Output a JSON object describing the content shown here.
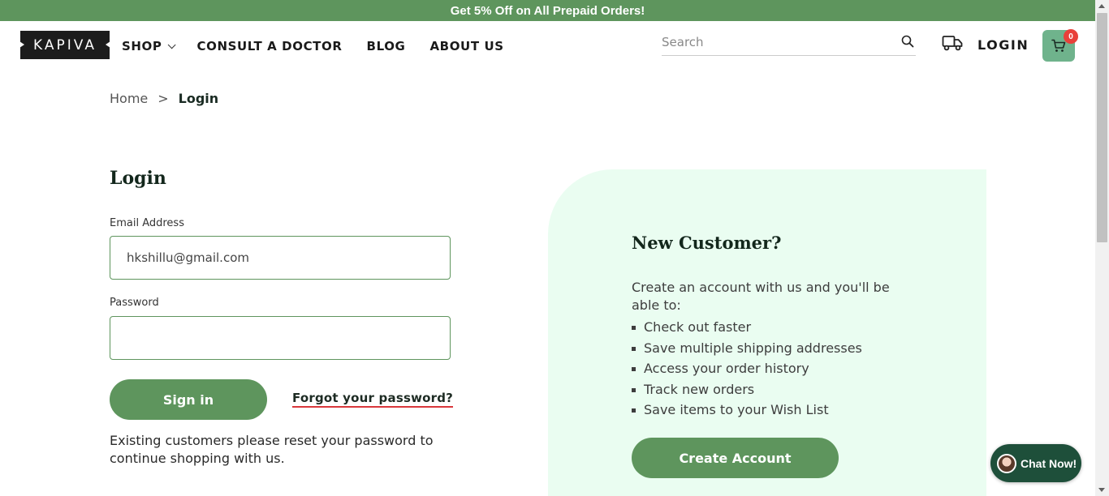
{
  "promo": {
    "text": "Get 5% Off on All Prepaid Orders!"
  },
  "header": {
    "logo_text": "KAPIVA",
    "nav": [
      {
        "label": "SHOP",
        "has_dropdown": true
      },
      {
        "label": "CONSULT A DOCTOR"
      },
      {
        "label": "BLOG"
      },
      {
        "label": "ABOUT US"
      }
    ],
    "search_placeholder": "Search",
    "login_label": "LOGIN",
    "cart_count": "0"
  },
  "breadcrumb": {
    "home": "Home",
    "separator": ">",
    "current": "Login"
  },
  "login_form": {
    "title": "Login",
    "email_label": "Email Address",
    "email_value": "hkshillu@gmail.com",
    "password_label": "Password",
    "password_value": "",
    "signin_label": "Sign in",
    "forgot_label": "Forgot your password?",
    "help_text": "Existing customers please reset your password to continue shopping with us."
  },
  "new_customer": {
    "title": "New Customer?",
    "intro": "Create an account with us and you'll be able to:",
    "benefits": [
      "Check out faster",
      "Save multiple shipping addresses",
      "Access your order history",
      "Track new orders",
      "Save items to your Wish List"
    ],
    "create_label": "Create Account"
  },
  "chat": {
    "label": "Chat Now!"
  },
  "colors": {
    "brand_green": "#5e955d",
    "cart_green": "#6fb38c",
    "panel_bg": "#eafdf1",
    "badge_red": "#e8413a",
    "chat_dark": "#1e4f3a"
  }
}
